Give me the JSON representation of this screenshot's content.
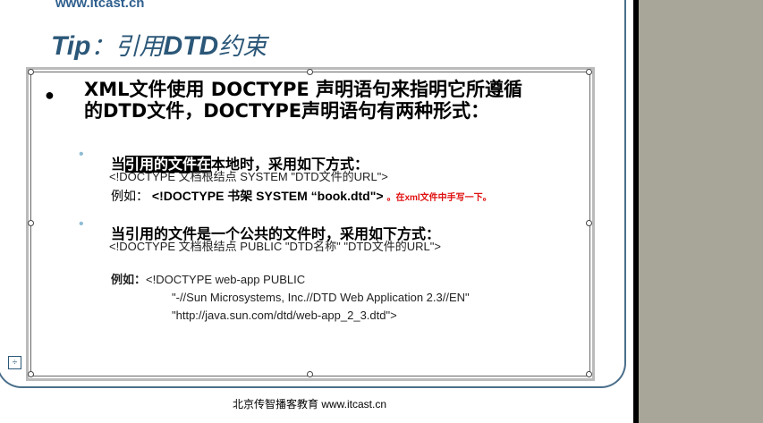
{
  "header": {
    "url": "www.itcast.cn"
  },
  "title": {
    "tip": "Tip",
    "colon": "：",
    "text_prefix": "引用",
    "text_bold": "DTD",
    "text_suffix": "约束"
  },
  "main": {
    "text_line1": "XML文件使用 DOCTYPE 声明语句来指明它所遵循",
    "text_line2": "的DTD文件，DOCTYPE声明语句有两种形式："
  },
  "section1": {
    "head_before": "当",
    "head_highlight": "引用的文件在",
    "head_after": "本地时，采用如下方式：",
    "code": "<!DOCTYPE 文档根结点 SYSTEM \"DTD文件的URL\">",
    "example_label": "例如：",
    "example_code": "<!DOCTYPE 书架 SYSTEM “book.dtd\">",
    "example_note": "。在xml文件中手写一下。"
  },
  "section2": {
    "head": "当引用的文件是一个公共的文件时，采用如下方式：",
    "code": "<!DOCTYPE 文档根结点 PUBLIC \"DTD名称\" \"DTD文件的URL\">",
    "example_label": "例如：",
    "example_line1": "<!DOCTYPE web-app PUBLIC",
    "example_line2": "\"-//Sun Microsystems, Inc.//DTD Web Application 2.3//EN\"",
    "example_line3": "\"http://java.sun.com/dtd/web-app_2_3.dtd\">"
  },
  "footer": {
    "text": "北京传智播客教育 www.itcast.cn"
  },
  "colors": {
    "title": "#2b5778",
    "note": "#e01010",
    "panel": "#a8a698"
  }
}
